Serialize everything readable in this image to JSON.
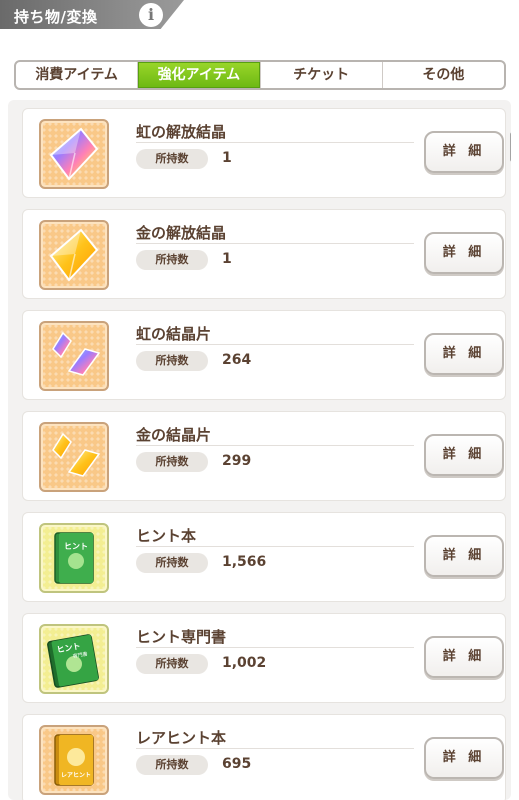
{
  "header": {
    "title": "持ち物/変換",
    "info_icon": "info-icon"
  },
  "tabs": [
    {
      "label": "消費アイテム",
      "active": false
    },
    {
      "label": "強化アイテム",
      "active": true
    },
    {
      "label": "チケット",
      "active": false
    },
    {
      "label": "その他",
      "active": false
    }
  ],
  "colors": {
    "accent": "#7cc31a",
    "text": "#5b4232"
  },
  "count_label": "所持数",
  "detail_label": "詳 細",
  "items": [
    {
      "name": "虹の解放結晶",
      "count": "1",
      "icon": "rainbow-crystal-icon"
    },
    {
      "name": "金の解放結晶",
      "count": "1",
      "icon": "gold-crystal-icon"
    },
    {
      "name": "虹の結晶片",
      "count": "264",
      "icon": "rainbow-shard-icon"
    },
    {
      "name": "金の結晶片",
      "count": "299",
      "icon": "gold-shard-icon"
    },
    {
      "name": "ヒント本",
      "count": "1,566",
      "icon": "hint-book-icon"
    },
    {
      "name": "ヒント専門書",
      "count": "1,002",
      "icon": "hint-textbook-icon"
    },
    {
      "name": "レアヒント本",
      "count": "695",
      "icon": "rare-hint-book-icon"
    }
  ],
  "book_cover_texts": {
    "hint_book": "ヒント",
    "hint_textbook": "ヒント",
    "hint_textbook_sub": "専門書",
    "rare_hint_book": "レアヒント"
  }
}
